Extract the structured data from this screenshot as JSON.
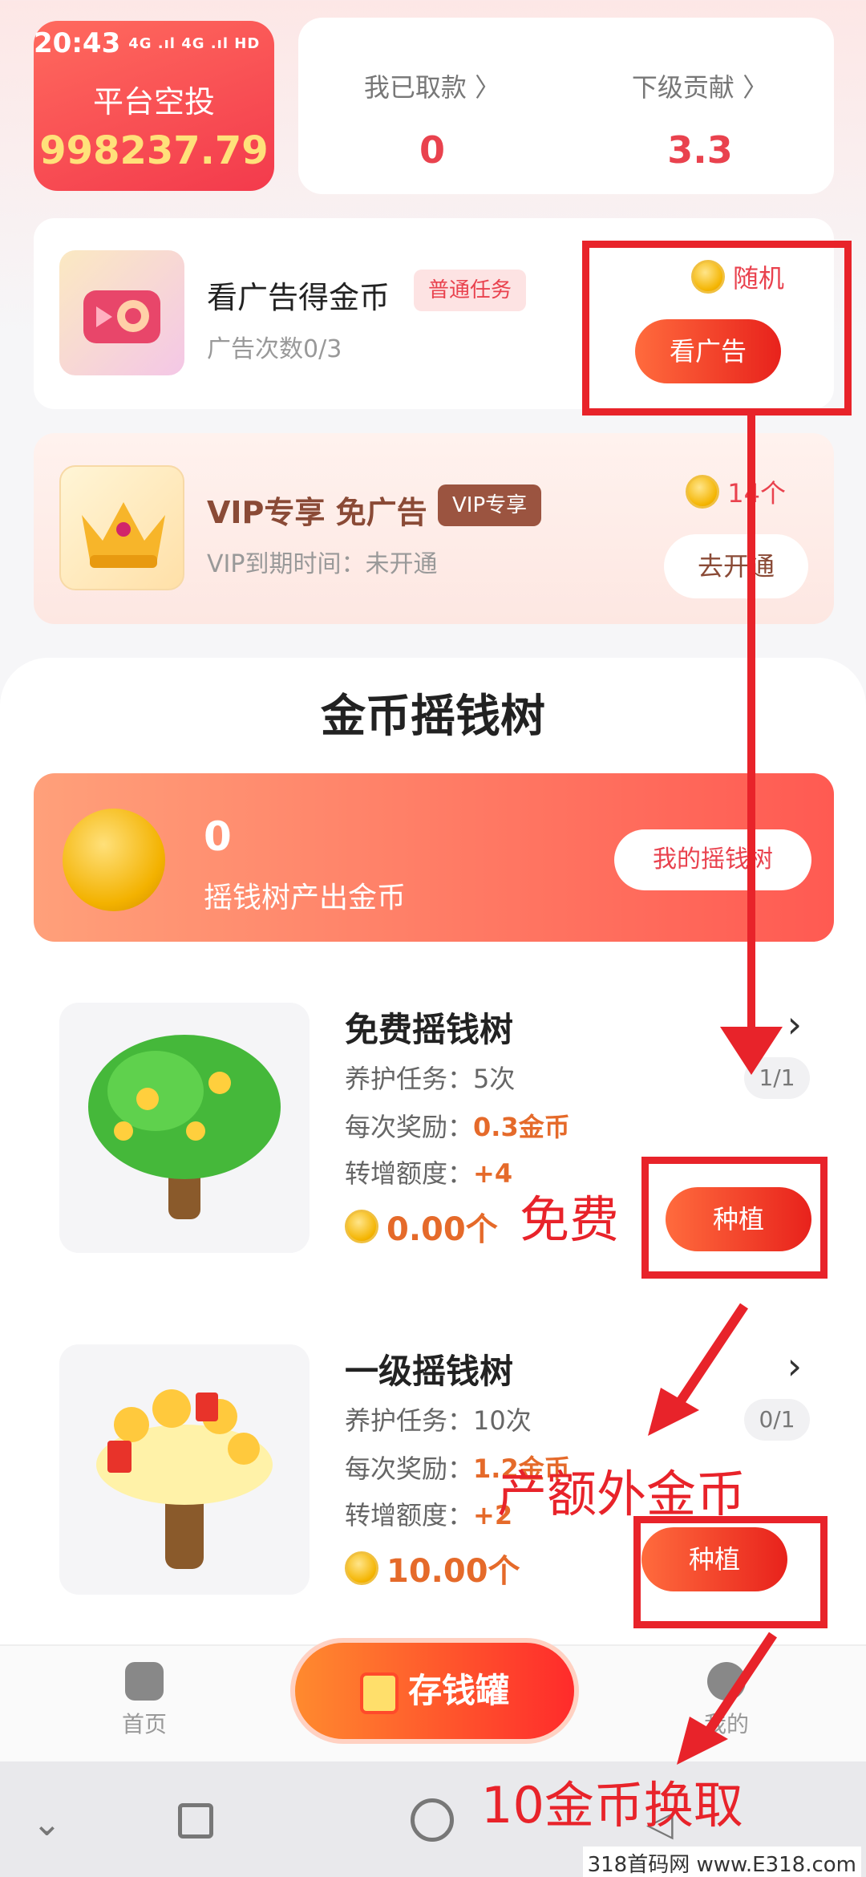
{
  "status_bar": {
    "time": "20:43",
    "signal": "4G .ıl 4G .ıl HD"
  },
  "airdrop": {
    "title": "平台空投",
    "value": "998237.79"
  },
  "stats": [
    {
      "label": "我已取款 〉",
      "value": "0"
    },
    {
      "label": "下级贡献 〉",
      "value": "3.3"
    }
  ],
  "task_ad": {
    "title": "看广告得金币",
    "tag": "普通任务",
    "subtitle": "广告次数0/3",
    "reward": "随机",
    "button": "看广告"
  },
  "task_vip": {
    "title": "VIP专享 免广告",
    "tag": "VIP专享",
    "subtitle": "VIP到期时间：未开通",
    "reward": "14个",
    "button": "去开通"
  },
  "money_tree": {
    "title": "金币摇钱树",
    "banner_value": "0",
    "banner_label": "摇钱树产出金币",
    "banner_button": "我的摇钱树",
    "trees": [
      {
        "name": "免费摇钱树",
        "care_label": "养护任务：",
        "care": "5次",
        "reward_label": "每次奖励：",
        "reward": "0.3金币",
        "bonus_label": "转增额度：",
        "bonus": "+4",
        "count": "1/1",
        "price": "0.00个",
        "button": "种植"
      },
      {
        "name": "一级摇钱树",
        "care_label": "养护任务：",
        "care": "10次",
        "reward_label": "每次奖励：",
        "reward": "1.2金币",
        "bonus_label": "转增额度：",
        "bonus": "+2",
        "count": "0/1",
        "price": "10.00个",
        "button": "种植"
      }
    ]
  },
  "bottom_nav": {
    "home": "首页",
    "center": "存钱罐",
    "mine": "我的"
  },
  "annotations": {
    "free": "免费",
    "extra": "产额外金币",
    "exchange": "10金币换取"
  },
  "watermark": "318首码网 www.E318.com",
  "colors": {
    "accent": "#e9424e",
    "annotation": "#e8232a",
    "orange": "#e56a2a"
  }
}
